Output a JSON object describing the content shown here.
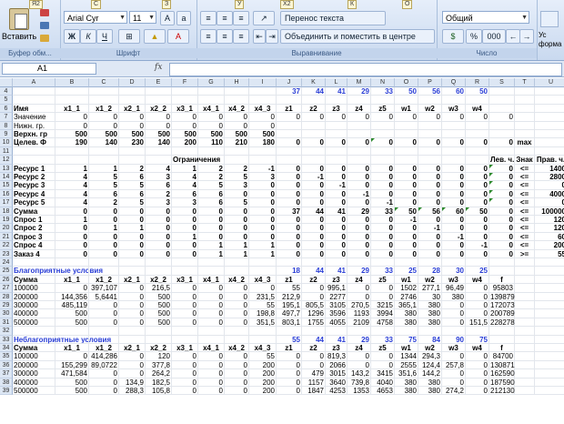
{
  "tabs_key": [
    "Я2",
    "С",
    "З",
    "У",
    "Х2",
    "К",
    "О"
  ],
  "clipboard": {
    "paste_label": "Вставить",
    "group": "Буфер обм..."
  },
  "font": {
    "name": "Arial Cyr",
    "size": "11",
    "bold": "Ж",
    "italic": "К",
    "underline": "Ч",
    "group": "Шрифт"
  },
  "alignment": {
    "wrap": "Перенос текста",
    "merge": "Объединить и поместить в центре",
    "group": "Выравнивание"
  },
  "number": {
    "format": "Общий",
    "percent": "%",
    "thousands": "000",
    "group": "Число"
  },
  "styles": {
    "cond": "Ус",
    "fmt": "форма"
  },
  "namebox": "A1",
  "fx": "fx",
  "columns": [
    "A",
    "B",
    "C",
    "D",
    "E",
    "F",
    "G",
    "H",
    "I",
    "J",
    "K",
    "L",
    "M",
    "N",
    "O",
    "P",
    "Q",
    "R",
    "S",
    "T",
    "U"
  ],
  "rows": [
    {
      "n": "4",
      "cells": [
        "",
        "",
        "",
        "",
        "",
        "",
        "",
        "",
        "",
        "37",
        "44",
        "41",
        "29",
        "33",
        "50",
        "56",
        "60",
        "50",
        "",
        "",
        ""
      ]
    },
    {
      "n": "5",
      "cells": [
        "",
        "",
        "",
        "",
        "",
        "",
        "",
        "",
        "",
        "",
        "",
        "",
        "",
        "",
        "",
        "",
        "",
        "",
        "",
        "",
        ""
      ]
    },
    {
      "n": "6",
      "cells": [
        "Имя",
        "x1_1",
        "x1_2",
        "x2_1",
        "x2_2",
        "x3_1",
        "x4_1",
        "x4_2",
        "x4_3",
        "z1",
        "z2",
        "z3",
        "z4",
        "z5",
        "w1",
        "w2",
        "w3",
        "w4",
        "",
        "",
        ""
      ]
    },
    {
      "n": "7",
      "cells": [
        "Значение",
        "0",
        "0",
        "0",
        "0",
        "0",
        "0",
        "0",
        "0",
        "0",
        "0",
        "0",
        "0",
        "0",
        "0",
        "0",
        "0",
        "0",
        "0",
        "",
        ""
      ]
    },
    {
      "n": "8",
      "cells": [
        "Нижн. гр.",
        "0",
        "0",
        "0",
        "0",
        "0",
        "0",
        "0",
        "0",
        "",
        "",
        "",
        "",
        "",
        "",
        "",
        "",
        "",
        "",
        "",
        ""
      ]
    },
    {
      "n": "9",
      "cells": [
        "Верхн. гр",
        "500",
        "500",
        "500",
        "500",
        "500",
        "500",
        "500",
        "500",
        "",
        "",
        "",
        "",
        "",
        "",
        "",
        "",
        "",
        "",
        "",
        ""
      ]
    },
    {
      "n": "10",
      "cells": [
        "Целев. Ф",
        "190",
        "140",
        "230",
        "140",
        "200",
        "110",
        "210",
        "180",
        "0",
        "0",
        "0",
        "0",
        "0",
        "0",
        "0",
        "0",
        "0",
        "0",
        "max",
        ""
      ]
    },
    {
      "n": "11",
      "cells": [
        "",
        "",
        "",
        "",
        "",
        "",
        "",
        "",
        "",
        "",
        "",
        "",
        "",
        "",
        "",
        "",
        "",
        "",
        "",
        "",
        ""
      ]
    },
    {
      "n": "12",
      "cells": [
        "",
        "",
        "",
        "",
        "",
        "Ограничения",
        "",
        "",
        "",
        "",
        "",
        "",
        "",
        "",
        "",
        "",
        "",
        "",
        "Лев. ч.",
        "Знак",
        "Прав. ч."
      ]
    },
    {
      "n": "13",
      "cells": [
        "Ресурс 1",
        "1",
        "1",
        "2",
        "4",
        "1",
        "2",
        "2",
        "-1",
        "0",
        "0",
        "0",
        "0",
        "0",
        "0",
        "0",
        "0",
        "0",
        "0",
        "<=",
        "1400"
      ]
    },
    {
      "n": "14",
      "cells": [
        "Ресурс 2",
        "4",
        "5",
        "6",
        "3",
        "4",
        "2",
        "5",
        "3",
        "0",
        "-1",
        "0",
        "0",
        "0",
        "0",
        "0",
        "0",
        "0",
        "0",
        "<=",
        "2800"
      ]
    },
    {
      "n": "15",
      "cells": [
        "Ресурс 3",
        "4",
        "5",
        "5",
        "6",
        "4",
        "5",
        "3",
        "0",
        "0",
        "0",
        "-1",
        "0",
        "0",
        "0",
        "0",
        "0",
        "0",
        "0",
        "<=",
        "0"
      ]
    },
    {
      "n": "16",
      "cells": [
        "Ресурс 4",
        "4",
        "6",
        "6",
        "2",
        "6",
        "6",
        "0",
        "0",
        "0",
        "0",
        "0",
        "-1",
        "0",
        "0",
        "0",
        "0",
        "0",
        "0",
        "<=",
        "4000"
      ]
    },
    {
      "n": "17",
      "cells": [
        "Ресурс 5",
        "4",
        "2",
        "5",
        "3",
        "3",
        "6",
        "5",
        "0",
        "0",
        "0",
        "0",
        "0",
        "-1",
        "0",
        "0",
        "0",
        "0",
        "0",
        "<=",
        "0"
      ]
    },
    {
      "n": "18",
      "cells": [
        "Сумма",
        "0",
        "0",
        "0",
        "0",
        "0",
        "0",
        "0",
        "0",
        "37",
        "44",
        "41",
        "29",
        "33",
        "50",
        "56",
        "60",
        "50",
        "0",
        "<=",
        "100000"
      ]
    },
    {
      "n": "19",
      "cells": [
        "Спрос 1",
        "1",
        "0",
        "0",
        "0",
        "0",
        "0",
        "0",
        "0",
        "0",
        "0",
        "0",
        "0",
        "0",
        "-1",
        "0",
        "0",
        "0",
        "0",
        "<=",
        "120"
      ]
    },
    {
      "n": "20",
      "cells": [
        "Спрос 2",
        "0",
        "1",
        "1",
        "0",
        "0",
        "0",
        "0",
        "0",
        "0",
        "0",
        "0",
        "0",
        "0",
        "0",
        "-1",
        "0",
        "0",
        "0",
        "<=",
        "120"
      ]
    },
    {
      "n": "21",
      "cells": [
        "Спрос 3",
        "0",
        "0",
        "0",
        "0",
        "1",
        "0",
        "0",
        "0",
        "0",
        "0",
        "0",
        "0",
        "0",
        "0",
        "0",
        "-1",
        "0",
        "0",
        "<=",
        "60"
      ]
    },
    {
      "n": "22",
      "cells": [
        "Спрос 4",
        "0",
        "0",
        "0",
        "0",
        "0",
        "1",
        "1",
        "1",
        "0",
        "0",
        "0",
        "0",
        "0",
        "0",
        "0",
        "0",
        "-1",
        "0",
        "<=",
        "200"
      ]
    },
    {
      "n": "23",
      "cells": [
        "Заказ 4",
        "0",
        "0",
        "0",
        "0",
        "0",
        "1",
        "1",
        "1",
        "0",
        "0",
        "0",
        "0",
        "0",
        "0",
        "0",
        "0",
        "0",
        "0",
        ">=",
        "55"
      ]
    },
    {
      "n": "24",
      "cells": [
        "",
        "",
        "",
        "",
        "",
        "",
        "",
        "",
        "",
        "",
        "",
        "",
        "",
        "",
        "",
        "",
        "",
        "",
        "",
        "",
        ""
      ]
    },
    {
      "n": "25",
      "cells": [
        "Благоприятные условия",
        "",
        "",
        "",
        "",
        "",
        "",
        "",
        "",
        "18",
        "44",
        "41",
        "29",
        "33",
        "25",
        "28",
        "30",
        "25",
        "",
        "",
        ""
      ]
    },
    {
      "n": "26",
      "cells": [
        "Сумма",
        "x1_1",
        "x1_2",
        "x2_1",
        "x2_2",
        "x3_1",
        "x4_1",
        "x4_2",
        "x4_3",
        "z1",
        "z2",
        "z3",
        "z4",
        "z5",
        "w1",
        "w2",
        "w3",
        "w4",
        "f",
        "",
        ""
      ]
    },
    {
      "n": "27",
      "cells": [
        "100000",
        "0",
        "397,107",
        "0",
        "216,5",
        "0",
        "0",
        "0",
        "0",
        "55",
        "0",
        "995,1",
        "0",
        "0",
        "1502",
        "277,1",
        "96,49",
        "0",
        "95803",
        "",
        ""
      ]
    },
    {
      "n": "28",
      "cells": [
        "200000",
        "144,356",
        "5,6441",
        "0",
        "500",
        "0",
        "0",
        "0",
        "231,5",
        "212,9",
        "0",
        "2277",
        "0",
        "0",
        "2746",
        "30",
        "380",
        "0",
        "139879",
        "",
        ""
      ]
    },
    {
      "n": "29",
      "cells": [
        "300000",
        "485,119",
        "0",
        "0",
        "500",
        "0",
        "0",
        "0",
        "55",
        "195,1",
        "805,5",
        "3105",
        "270,5",
        "3215",
        "365,1",
        "380",
        "0",
        "0",
        "172073",
        "",
        ""
      ]
    },
    {
      "n": "30",
      "cells": [
        "400000",
        "500",
        "0",
        "0",
        "500",
        "0",
        "0",
        "0",
        "198,8",
        "497,7",
        "1296",
        "3596",
        "1193",
        "3994",
        "380",
        "380",
        "0",
        "0",
        "200789",
        "",
        ""
      ]
    },
    {
      "n": "31",
      "cells": [
        "500000",
        "500",
        "0",
        "0",
        "500",
        "0",
        "0",
        "0",
        "351,5",
        "803,1",
        "1755",
        "4055",
        "2109",
        "4758",
        "380",
        "380",
        "0",
        "151,5",
        "228278",
        "",
        ""
      ]
    },
    {
      "n": "32",
      "cells": [
        "",
        "",
        "",
        "",
        "",
        "",
        "",
        "",
        "",
        "",
        "",
        "",
        "",
        "",
        "",
        "",
        "",
        "",
        "",
        "",
        ""
      ]
    },
    {
      "n": "33",
      "cells": [
        "Неблагоприятные условия",
        "",
        "",
        "",
        "",
        "",
        "",
        "",
        "",
        "55",
        "44",
        "41",
        "29",
        "33",
        "75",
        "84",
        "90",
        "75",
        "",
        "",
        ""
      ]
    },
    {
      "n": "34",
      "cells": [
        "Сумма",
        "x1_1",
        "x1_2",
        "x2_1",
        "x2_2",
        "x3_1",
        "x4_1",
        "x4_2",
        "x4_3",
        "z1",
        "z2",
        "z3",
        "z4",
        "z5",
        "w1",
        "w2",
        "w3",
        "w4",
        "f",
        "",
        ""
      ]
    },
    {
      "n": "35",
      "cells": [
        "100000",
        "0",
        "414,286",
        "0",
        "120",
        "0",
        "0",
        "0",
        "55",
        "0",
        "0",
        "819,3",
        "0",
        "0",
        "1344",
        "294,3",
        "0",
        "0",
        "84700",
        "",
        ""
      ]
    },
    {
      "n": "36",
      "cells": [
        "200000",
        "155,299",
        "89,0722",
        "0",
        "377,8",
        "0",
        "0",
        "0",
        "200",
        "0",
        "0",
        "2066",
        "0",
        "0",
        "2555",
        "124,4",
        "257,8",
        "0",
        "130871",
        "",
        ""
      ]
    },
    {
      "n": "37",
      "cells": [
        "300000",
        "471,584",
        "0",
        "0",
        "264,2",
        "0",
        "0",
        "0",
        "200",
        "0",
        "479",
        "3015",
        "143,2",
        "3415",
        "351,6",
        "144,2",
        "0",
        "0",
        "162590",
        "",
        ""
      ]
    },
    {
      "n": "38",
      "cells": [
        "400000",
        "500",
        "0",
        "134,9",
        "182,5",
        "0",
        "0",
        "0",
        "200",
        "0",
        "1157",
        "3640",
        "739,8",
        "4040",
        "380",
        "380",
        "0",
        "0",
        "187590",
        "",
        ""
      ]
    },
    {
      "n": "39",
      "cells": [
        "500000",
        "500",
        "0",
        "288,3",
        "105,8",
        "0",
        "0",
        "0",
        "200",
        "0",
        "1847",
        "4253",
        "1353",
        "4653",
        "380",
        "380",
        "274,2",
        "0",
        "212130",
        "",
        ""
      ]
    }
  ]
}
